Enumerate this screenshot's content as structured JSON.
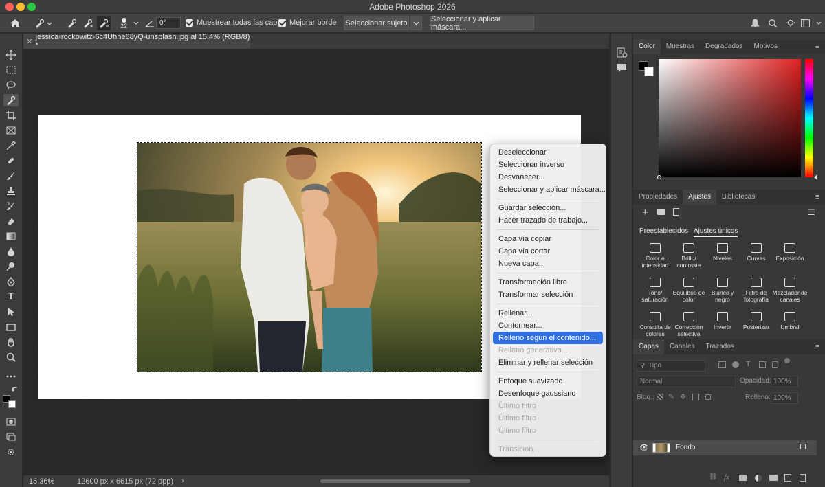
{
  "window": {
    "title": "Adobe Photoshop 2026"
  },
  "options_bar": {
    "brush_size": "22",
    "angle_value": "0°",
    "sample_all_layers_label": "Muestrear todas las capas",
    "enhance_edge_label": "Mejorar borde",
    "select_subject_label": "Seleccionar sujeto",
    "select_mask_label": "Seleccionar y aplicar máscara..."
  },
  "document_tab": {
    "label": "jessica-rockowitz-6c4Uhhe68yQ-unsplash.jpg al 15.4% (RGB/8) *"
  },
  "status_bar": {
    "zoom": "15.36%",
    "doc_size": "12600 px x 6615 px (72 ppp)"
  },
  "context_menu": {
    "groups": [
      [
        {
          "label": "Deseleccionar",
          "enabled": true,
          "selected": false
        },
        {
          "label": "Seleccionar inverso",
          "enabled": true,
          "selected": false
        },
        {
          "label": "Desvanecer...",
          "enabled": true,
          "selected": false
        },
        {
          "label": "Seleccionar y aplicar máscara...",
          "enabled": true,
          "selected": false
        }
      ],
      [
        {
          "label": "Guardar selección...",
          "enabled": true,
          "selected": false
        },
        {
          "label": "Hacer trazado de trabajo...",
          "enabled": true,
          "selected": false
        }
      ],
      [
        {
          "label": "Capa vía copiar",
          "enabled": true,
          "selected": false
        },
        {
          "label": "Capa vía cortar",
          "enabled": true,
          "selected": false
        },
        {
          "label": "Nueva capa...",
          "enabled": true,
          "selected": false
        }
      ],
      [
        {
          "label": "Transformación libre",
          "enabled": true,
          "selected": false
        },
        {
          "label": "Transformar selección",
          "enabled": true,
          "selected": false
        }
      ],
      [
        {
          "label": "Rellenar...",
          "enabled": true,
          "selected": false
        },
        {
          "label": "Contornear...",
          "enabled": true,
          "selected": false
        },
        {
          "label": "Relleno según el contenido...",
          "enabled": true,
          "selected": true
        },
        {
          "label": "Relleno generativo...",
          "enabled": false,
          "selected": false
        },
        {
          "label": "Eliminar y rellenar selección",
          "enabled": true,
          "selected": false
        }
      ],
      [
        {
          "label": "Enfoque suavizado",
          "enabled": true,
          "selected": false
        },
        {
          "label": "Desenfoque gaussiano",
          "enabled": true,
          "selected": false
        },
        {
          "label": "Último filtro",
          "enabled": false,
          "selected": false
        },
        {
          "label": "Último filtro",
          "enabled": false,
          "selected": false
        },
        {
          "label": "Último filtro",
          "enabled": false,
          "selected": false
        }
      ],
      [
        {
          "label": "Transición...",
          "enabled": false,
          "selected": false
        }
      ]
    ]
  },
  "color_panel": {
    "tabs": [
      "Color",
      "Muestras",
      "Degradados",
      "Motivos"
    ],
    "active_tab": "Color"
  },
  "adjust_panel": {
    "tabs": [
      "Propiedades",
      "Ajustes",
      "Bibliotecas"
    ],
    "active_tab": "Ajustes",
    "subtabs": [
      "Preestablecidos",
      "Ajustes únicos"
    ],
    "active_subtab": "Ajustes únicos",
    "items": [
      {
        "label": "Color e intensidad",
        "icon": "triangle-down-icon"
      },
      {
        "label": "Brillo/ contraste",
        "icon": "sun-icon"
      },
      {
        "label": "Niveles",
        "icon": "histogram-icon"
      },
      {
        "label": "Curvas",
        "icon": "curves-icon"
      },
      {
        "label": "Exposición",
        "icon": "exposure-icon"
      },
      {
        "label": "Tono/ saturación",
        "icon": "hue-icon"
      },
      {
        "label": "Equilibrio de color",
        "icon": "scale-icon"
      },
      {
        "label": "Blanco y negro",
        "icon": "bw-icon"
      },
      {
        "label": "Filtro de fotografía",
        "icon": "camera-icon"
      },
      {
        "label": "Mezclador de canales",
        "icon": "mixer-icon"
      },
      {
        "label": "Consulta de colores",
        "icon": "grid-icon"
      },
      {
        "label": "Corrección selectiva",
        "icon": "selective-icon"
      },
      {
        "label": "Invertir",
        "icon": "invert-icon"
      },
      {
        "label": "Posterizar",
        "icon": "posterize-icon"
      },
      {
        "label": "Umbral",
        "icon": "threshold-icon"
      }
    ]
  },
  "layers_panel": {
    "tabs": [
      "Capas",
      "Canales",
      "Trazados"
    ],
    "active_tab": "Capas",
    "kind_placeholder": "Tipo",
    "blend_mode": "Normal",
    "opacity_label": "Opacidad:",
    "opacity_value": "100%",
    "lock_label": "Bloq.:",
    "fill_label": "Relleno:",
    "fill_value": "100%",
    "layers": [
      {
        "name": "Fondo",
        "locked": true,
        "visible": true
      }
    ]
  },
  "colors": {
    "accent": "#2f6fe0",
    "foreground": "#000000",
    "background": "#ffffff"
  }
}
